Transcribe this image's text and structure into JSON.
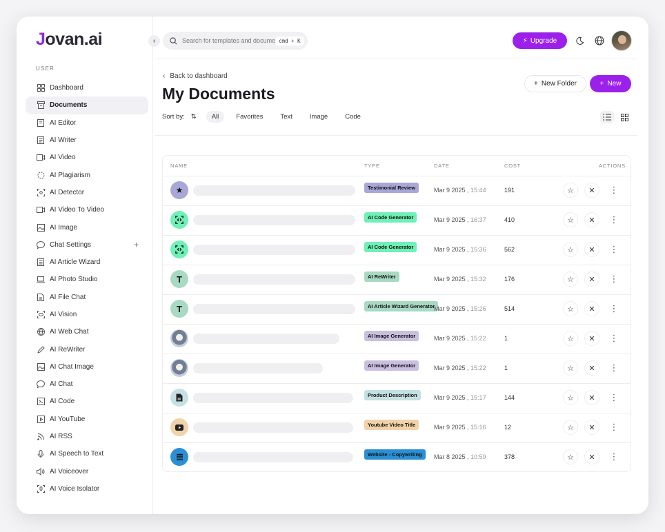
{
  "brand": {
    "logo_first": "J",
    "logo_rest": "ovan.ai"
  },
  "sidebar": {
    "section_label": "USER",
    "items": [
      {
        "label": "Dashboard",
        "icon": "dashboard-icon"
      },
      {
        "label": "Documents",
        "icon": "archive-icon",
        "active": true
      },
      {
        "label": "AI Editor",
        "icon": "editor-icon"
      },
      {
        "label": "AI Writer",
        "icon": "document-icon"
      },
      {
        "label": "AI Video",
        "icon": "video-icon"
      },
      {
        "label": "AI Plagiarism",
        "icon": "plagiarism-icon"
      },
      {
        "label": "AI Detector",
        "icon": "scan-icon"
      },
      {
        "label": "AI Video To Video",
        "icon": "video-icon"
      },
      {
        "label": "AI Image",
        "icon": "image-icon"
      },
      {
        "label": "Chat Settings",
        "icon": "chat-icon",
        "plus": "+"
      },
      {
        "label": "AI Article Wizard",
        "icon": "article-icon"
      },
      {
        "label": "AI Photo Studio",
        "icon": "laptop-icon"
      },
      {
        "label": "AI File Chat",
        "icon": "file-icon"
      },
      {
        "label": "AI Vision",
        "icon": "eye-icon"
      },
      {
        "label": "AI Web Chat",
        "icon": "globe-icon"
      },
      {
        "label": "AI ReWriter",
        "icon": "pen-icon"
      },
      {
        "label": "AI Chat Image",
        "icon": "image-icon"
      },
      {
        "label": "AI Chat",
        "icon": "chat-icon"
      },
      {
        "label": "AI Code",
        "icon": "terminal-icon"
      },
      {
        "label": "AI YouTube",
        "icon": "youtube-icon"
      },
      {
        "label": "AI RSS",
        "icon": "rss-icon"
      },
      {
        "label": "AI Speech to Text",
        "icon": "mic-icon"
      },
      {
        "label": "AI Voiceover",
        "icon": "speaker-icon"
      },
      {
        "label": "AI Voice Isolator",
        "icon": "voice-icon"
      }
    ]
  },
  "header": {
    "search_placeholder": "Search for templates and documents",
    "shortcut": "cmd + K",
    "upgrade_label": "Upgrade"
  },
  "page": {
    "back_label": "Back to dashboard",
    "title": "My Documents",
    "sort_label": "Sort by:",
    "filters": [
      "All",
      "Favorites",
      "Text",
      "Image",
      "Code"
    ],
    "active_filter": "All",
    "new_folder_label": "New Folder",
    "new_label": "New"
  },
  "table": {
    "columns": {
      "name": "NAME",
      "type": "TYPE",
      "date": "DATE",
      "cost": "COST",
      "actions": "ACTIONS"
    },
    "rows": [
      {
        "icon": "star-icon",
        "icon_color": "#a9a6d8",
        "type": "Testimonial Review",
        "type_color": "#a9a6d8",
        "date": "Mar 9 2025",
        "time": "15:44",
        "cost": "191",
        "bar": 235
      },
      {
        "icon": "code-scan-icon",
        "icon_color": "#6ff0b6",
        "type": "AI Code Generator",
        "type_color": "#6ff0b6",
        "date": "Mar 9 2025",
        "time": "16:37",
        "cost": "410",
        "bar": 235
      },
      {
        "icon": "code-scan-icon",
        "icon_color": "#6ff0b6",
        "type": "AI Code Generator",
        "type_color": "#6ff0b6",
        "date": "Mar 9 2025",
        "time": "15:36",
        "cost": "562",
        "bar": 235
      },
      {
        "icon": "text-icon",
        "icon_color": "#a8d9c3",
        "type": "AI ReWriter",
        "type_color": "#a8d9c3",
        "date": "Mar 9 2025",
        "time": "15:32",
        "cost": "176",
        "bar": 235
      },
      {
        "icon": "text-icon",
        "icon_color": "#a8d9c3",
        "type": "AI Article Wizard Generator",
        "type_color": "#a8d9c3",
        "date": "Mar 9 2025",
        "time": "15:26",
        "cost": "514",
        "bar": 235
      },
      {
        "icon": "photo-thumbnail-icon",
        "icon_color": "#8aa0b8",
        "type": "AI Image Generator",
        "type_color": "#cbbfe0",
        "date": "Mar 9 2025",
        "time": "15:22",
        "cost": "1",
        "bar": 212
      },
      {
        "icon": "photo-thumbnail-icon",
        "icon_color": "#8aa0b8",
        "type": "AI Image Generator",
        "type_color": "#cbbfe0",
        "date": "Mar 9 2025",
        "time": "15:22",
        "cost": "1",
        "bar": 188
      },
      {
        "icon": "file-icon",
        "icon_color": "#c5e0e3",
        "type": "Product Description",
        "type_color": "#c5e0e3",
        "date": "Mar 9 2025",
        "time": "15:17",
        "cost": "144",
        "bar": 232
      },
      {
        "icon": "youtube-icon",
        "icon_color": "#f0d3a8",
        "type": "Youtube Video Title",
        "type_color": "#f0d3a8",
        "date": "Mar 9 2025",
        "time": "15:16",
        "cost": "12",
        "bar": 232
      },
      {
        "icon": "list-icon",
        "icon_color": "#2b8fd6",
        "type": "Website - Copywriting",
        "type_color": "#2b8fd6",
        "date": "Mar 8 2025",
        "time": "10:59",
        "cost": "378",
        "bar": 232
      }
    ]
  }
}
